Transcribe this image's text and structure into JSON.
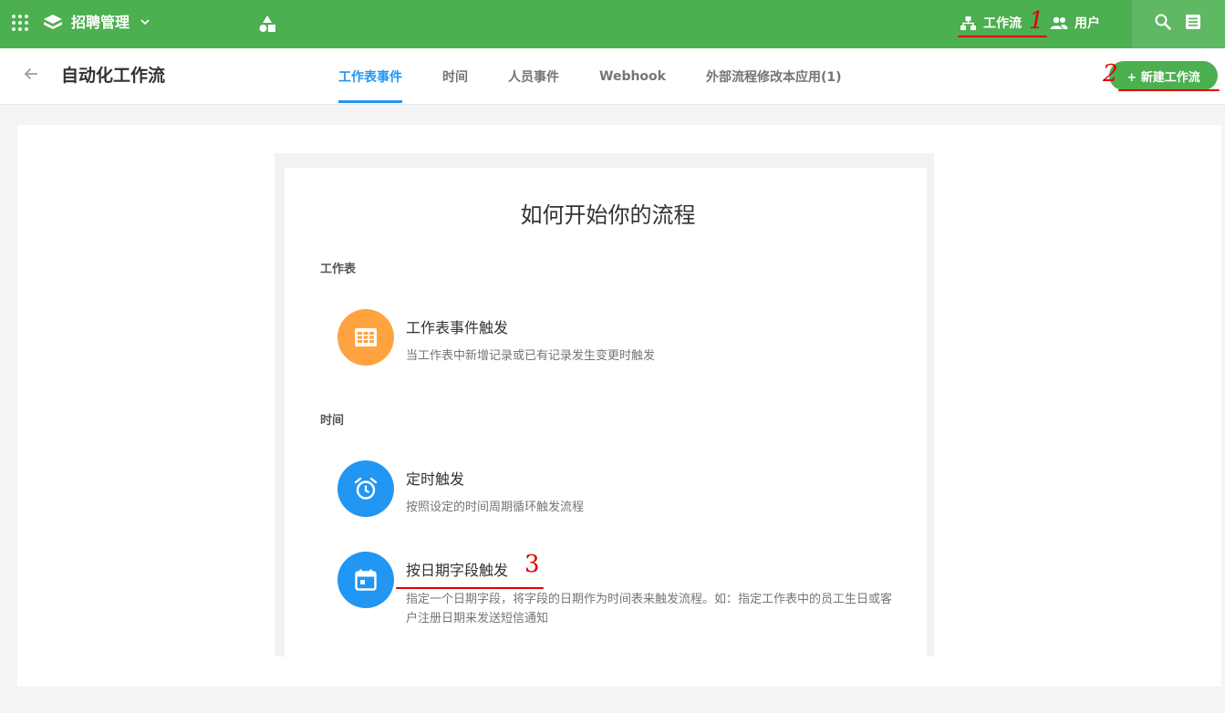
{
  "topbar": {
    "app_name": "招聘管理",
    "nav_workflow": "工作流",
    "nav_users": "用户"
  },
  "header": {
    "page_title": "自动化工作流",
    "tabs": [
      {
        "label": "工作表事件",
        "active": true
      },
      {
        "label": "时间",
        "active": false
      },
      {
        "label": "人员事件",
        "active": false
      },
      {
        "label": "Webhook",
        "active": false
      },
      {
        "label": "外部流程修改本应用(1)",
        "active": false
      }
    ],
    "new_button": "+ 新建工作流"
  },
  "main": {
    "heading": "如何开始你的流程",
    "sections": [
      {
        "label": "工作表",
        "items": [
          {
            "title": "工作表事件触发",
            "desc": "当工作表中新增记录或已有记录发生变更时触发",
            "icon": "table-grid-icon",
            "color": "#ffa340"
          }
        ]
      },
      {
        "label": "时间",
        "items": [
          {
            "title": "定时触发",
            "desc": "按照设定的时间周期循环触发流程",
            "icon": "alarm-clock-icon",
            "color": "#2196f3"
          },
          {
            "title": "按日期字段触发",
            "desc": "指定一个日期字段，将字段的日期作为时间表来触发流程。如：指定工作表中的员工生日或客户注册日期来发送短信通知",
            "icon": "calendar-icon",
            "color": "#2196f3"
          }
        ]
      }
    ]
  },
  "annotations": {
    "one": "1",
    "two": "2",
    "three": "3"
  },
  "colors": {
    "brand_green": "#4caf50",
    "accent_blue": "#2196f3",
    "orange": "#ffa340",
    "annotation_red": "#e00000"
  }
}
